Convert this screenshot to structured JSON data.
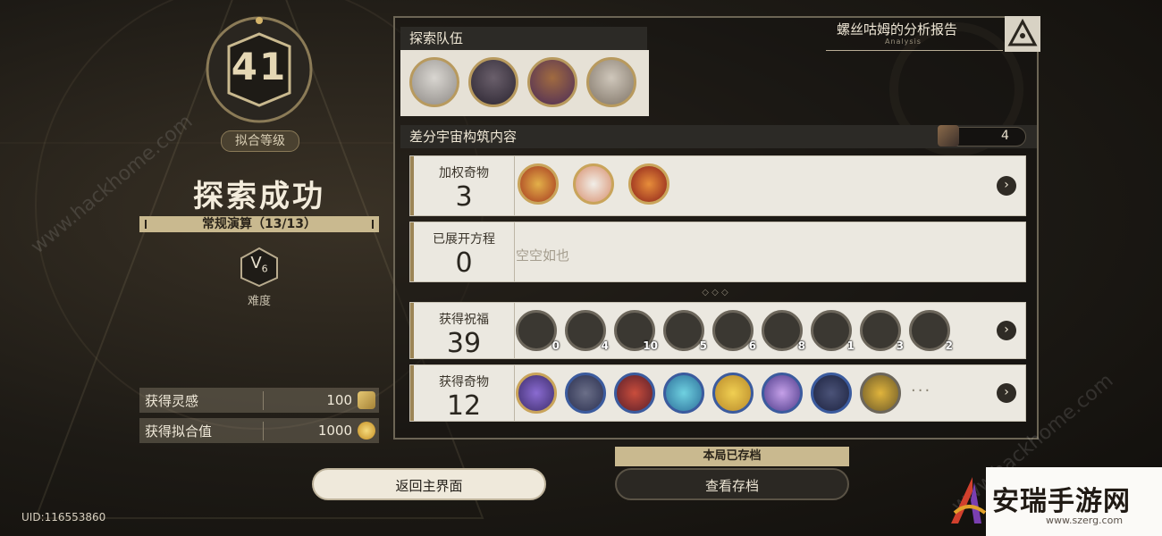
{
  "level": {
    "value": "41",
    "label": "拟合等级"
  },
  "result": {
    "title": "探索成功",
    "mode": "常规演算（13/13）"
  },
  "difficulty": {
    "value": "V",
    "sub": "6",
    "label": "难度"
  },
  "stats": [
    {
      "label": "获得灵感",
      "value": "100",
      "icon": "inspiration-ticket-icon"
    },
    {
      "label": "获得拟合值",
      "value": "1000",
      "icon": "fitting-coin-icon"
    }
  ],
  "team": {
    "title": "探索队伍",
    "members": [
      "avatar-1",
      "avatar-2",
      "avatar-3",
      "avatar-4"
    ]
  },
  "report": {
    "title": "螺丝咕姆的分析报告",
    "sub": "Analysis"
  },
  "construct": {
    "title": "差分宇宙构筑内容",
    "count": "4",
    "weighted_curios": {
      "label": "加权奇物",
      "value": "3"
    },
    "equations": {
      "label": "已展开方程",
      "value": "0",
      "empty": "空空如也"
    },
    "blessings": {
      "label": "获得祝福",
      "value": "39",
      "counts": [
        "0",
        "4",
        "10",
        "5",
        "6",
        "8",
        "1",
        "3",
        "2"
      ]
    },
    "curios": {
      "label": "获得奇物",
      "value": "12",
      "more": "···"
    }
  },
  "buttons": {
    "home": "返回主界面",
    "view_save": "查看存档",
    "saved": "本局已存档"
  },
  "uid": "UID:116553860",
  "logo": {
    "text": "安瑞手游网",
    "url": "www.szerg.com"
  },
  "watermark": {
    "left": "www.hackhome.com",
    "right": "www.hackhome.com"
  }
}
